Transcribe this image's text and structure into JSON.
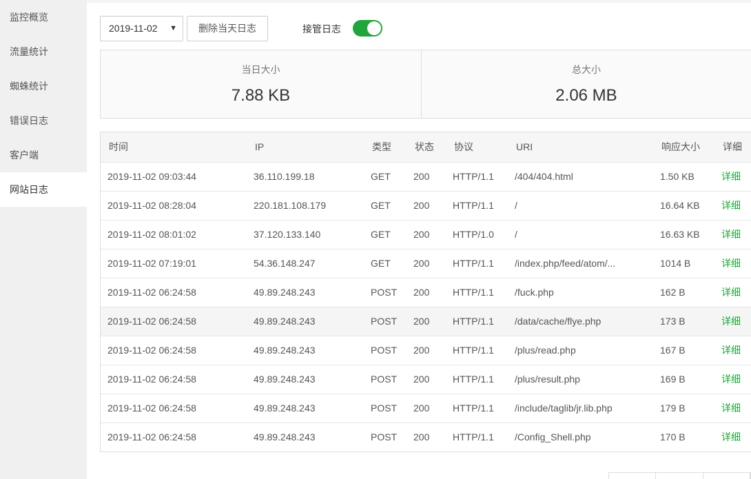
{
  "sidebar": {
    "items": [
      {
        "label": "监控概览"
      },
      {
        "label": "流量统计"
      },
      {
        "label": "蜘蛛统计"
      },
      {
        "label": "错误日志"
      },
      {
        "label": "客户端"
      },
      {
        "label": "网站日志"
      }
    ],
    "active": "网站日志"
  },
  "toolbar": {
    "date": "2019-11-02",
    "delete_label": "删除当天日志",
    "takeover_label": "接管日志",
    "takeover_on": true
  },
  "stats": {
    "today_label": "当日大小",
    "today_value": "7.88 KB",
    "total_label": "总大小",
    "total_value": "2.06 MB"
  },
  "table": {
    "headers": [
      "时间",
      "IP",
      "类型",
      "状态",
      "协议",
      "URI",
      "响应大小",
      "详细"
    ],
    "rows": [
      {
        "time": "2019-11-02 09:03:44",
        "ip": "36.110.199.18",
        "type": "GET",
        "status": "200",
        "protocol": "HTTP/1.1",
        "uri": "/404/404.html",
        "size": "1.50 KB",
        "detail": "详细"
      },
      {
        "time": "2019-11-02 08:28:04",
        "ip": "220.181.108.179",
        "type": "GET",
        "status": "200",
        "protocol": "HTTP/1.1",
        "uri": "/",
        "size": "16.64 KB",
        "detail": "详细"
      },
      {
        "time": "2019-11-02 08:01:02",
        "ip": "37.120.133.140",
        "type": "GET",
        "status": "200",
        "protocol": "HTTP/1.0",
        "uri": "/",
        "size": "16.63 KB",
        "detail": "详细"
      },
      {
        "time": "2019-11-02 07:19:01",
        "ip": "54.36.148.247",
        "type": "GET",
        "status": "200",
        "protocol": "HTTP/1.1",
        "uri": "/index.php/feed/atom/...",
        "size": "1014 B",
        "detail": "详细"
      },
      {
        "time": "2019-11-02 06:24:58",
        "ip": "49.89.248.243",
        "type": "POST",
        "status": "200",
        "protocol": "HTTP/1.1",
        "uri": "/fuck.php",
        "size": "162 B",
        "detail": "详细"
      },
      {
        "time": "2019-11-02 06:24:58",
        "ip": "49.89.248.243",
        "type": "POST",
        "status": "200",
        "protocol": "HTTP/1.1",
        "uri": "/data/cache/flye.php",
        "size": "173 B",
        "detail": "详细"
      },
      {
        "time": "2019-11-02 06:24:58",
        "ip": "49.89.248.243",
        "type": "POST",
        "status": "200",
        "protocol": "HTTP/1.1",
        "uri": "/plus/read.php",
        "size": "167 B",
        "detail": "详细"
      },
      {
        "time": "2019-11-02 06:24:58",
        "ip": "49.89.248.243",
        "type": "POST",
        "status": "200",
        "protocol": "HTTP/1.1",
        "uri": "/plus/result.php",
        "size": "169 B",
        "detail": "详细"
      },
      {
        "time": "2019-11-02 06:24:58",
        "ip": "49.89.248.243",
        "type": "POST",
        "status": "200",
        "protocol": "HTTP/1.1",
        "uri": "/include/taglib/jr.lib.php",
        "size": "179 B",
        "detail": "详细"
      },
      {
        "time": "2019-11-02 06:24:58",
        "ip": "49.89.248.243",
        "type": "POST",
        "status": "200",
        "protocol": "HTTP/1.1",
        "uri": "/Config_Shell.php",
        "size": "170 B",
        "detail": "详细"
      }
    ],
    "highlighted_row": 5
  },
  "colors": {
    "accent": "#20a53a",
    "sidebar_bg": "#f0f0f0",
    "header_bg": "#f6f6f6"
  }
}
